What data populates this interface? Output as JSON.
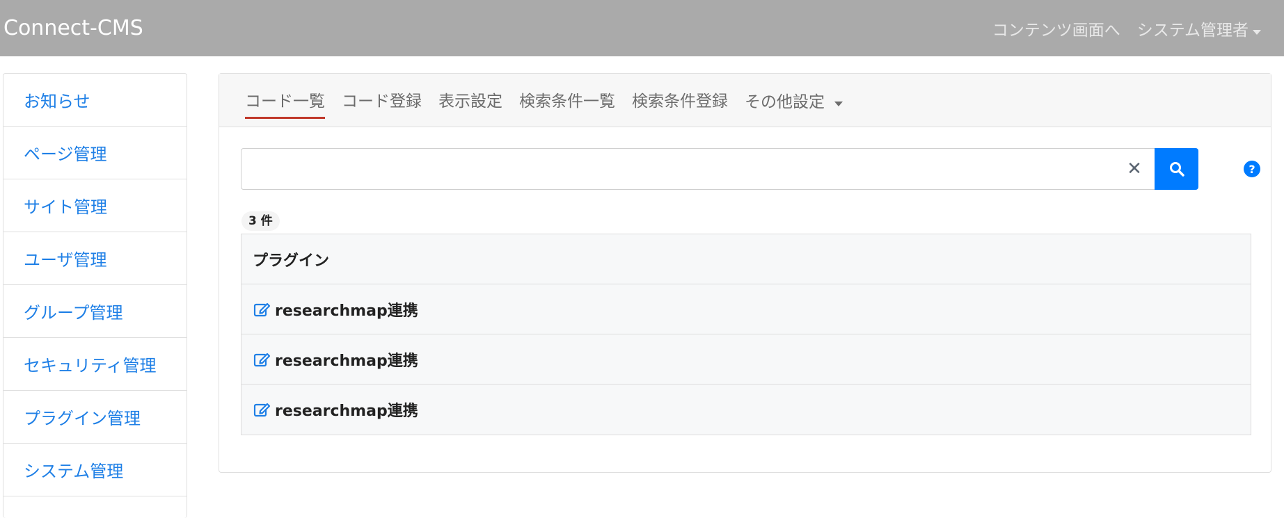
{
  "app": {
    "brand": "Connect-CMS",
    "nav_content_link": "コンテンツ画面へ",
    "nav_user_menu": "システム管理者"
  },
  "sidebar": {
    "items": [
      {
        "label": "お知らせ"
      },
      {
        "label": "ページ管理"
      },
      {
        "label": "サイト管理"
      },
      {
        "label": "ユーザ管理"
      },
      {
        "label": "グループ管理"
      },
      {
        "label": "セキュリティ管理"
      },
      {
        "label": "プラグイン管理"
      },
      {
        "label": "システム管理"
      }
    ]
  },
  "tabs": [
    {
      "label": "コード一覧",
      "active": true
    },
    {
      "label": "コード登録"
    },
    {
      "label": "表示設定"
    },
    {
      "label": "検索条件一覧"
    },
    {
      "label": "検索条件登録"
    },
    {
      "label": "その他設定"
    }
  ],
  "search": {
    "value": "",
    "placeholder": "",
    "clear_icon": "close-icon",
    "button_icon": "search-icon",
    "help_icon": "question-circle-icon"
  },
  "count_label": "3 件",
  "table": {
    "header": "プラグイン",
    "rows": [
      {
        "label": "researchmap連携",
        "icon": "edit-icon"
      },
      {
        "label": "researchmap連携",
        "icon": "edit-icon"
      },
      {
        "label": "researchmap連携",
        "icon": "edit-icon"
      }
    ]
  },
  "colors": {
    "navbar": "#aaaaaa",
    "link": "#1e7fe6",
    "primary": "#007bff",
    "active_tab_underline": "#c0392b"
  }
}
